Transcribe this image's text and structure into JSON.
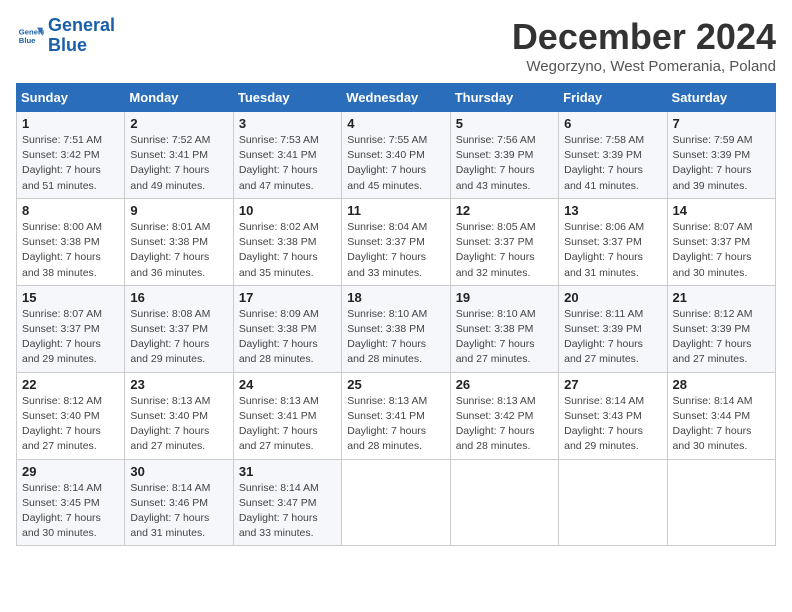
{
  "logo": {
    "line1": "General",
    "line2": "Blue"
  },
  "title": "December 2024",
  "subtitle": "Wegorzyno, West Pomerania, Poland",
  "headers": [
    "Sunday",
    "Monday",
    "Tuesday",
    "Wednesday",
    "Thursday",
    "Friday",
    "Saturday"
  ],
  "weeks": [
    [
      {
        "day": "1",
        "info": "Sunrise: 7:51 AM\nSunset: 3:42 PM\nDaylight: 7 hours\nand 51 minutes."
      },
      {
        "day": "2",
        "info": "Sunrise: 7:52 AM\nSunset: 3:41 PM\nDaylight: 7 hours\nand 49 minutes."
      },
      {
        "day": "3",
        "info": "Sunrise: 7:53 AM\nSunset: 3:41 PM\nDaylight: 7 hours\nand 47 minutes."
      },
      {
        "day": "4",
        "info": "Sunrise: 7:55 AM\nSunset: 3:40 PM\nDaylight: 7 hours\nand 45 minutes."
      },
      {
        "day": "5",
        "info": "Sunrise: 7:56 AM\nSunset: 3:39 PM\nDaylight: 7 hours\nand 43 minutes."
      },
      {
        "day": "6",
        "info": "Sunrise: 7:58 AM\nSunset: 3:39 PM\nDaylight: 7 hours\nand 41 minutes."
      },
      {
        "day": "7",
        "info": "Sunrise: 7:59 AM\nSunset: 3:39 PM\nDaylight: 7 hours\nand 39 minutes."
      }
    ],
    [
      {
        "day": "8",
        "info": "Sunrise: 8:00 AM\nSunset: 3:38 PM\nDaylight: 7 hours\nand 38 minutes."
      },
      {
        "day": "9",
        "info": "Sunrise: 8:01 AM\nSunset: 3:38 PM\nDaylight: 7 hours\nand 36 minutes."
      },
      {
        "day": "10",
        "info": "Sunrise: 8:02 AM\nSunset: 3:38 PM\nDaylight: 7 hours\nand 35 minutes."
      },
      {
        "day": "11",
        "info": "Sunrise: 8:04 AM\nSunset: 3:37 PM\nDaylight: 7 hours\nand 33 minutes."
      },
      {
        "day": "12",
        "info": "Sunrise: 8:05 AM\nSunset: 3:37 PM\nDaylight: 7 hours\nand 32 minutes."
      },
      {
        "day": "13",
        "info": "Sunrise: 8:06 AM\nSunset: 3:37 PM\nDaylight: 7 hours\nand 31 minutes."
      },
      {
        "day": "14",
        "info": "Sunrise: 8:07 AM\nSunset: 3:37 PM\nDaylight: 7 hours\nand 30 minutes."
      }
    ],
    [
      {
        "day": "15",
        "info": "Sunrise: 8:07 AM\nSunset: 3:37 PM\nDaylight: 7 hours\nand 29 minutes."
      },
      {
        "day": "16",
        "info": "Sunrise: 8:08 AM\nSunset: 3:37 PM\nDaylight: 7 hours\nand 29 minutes."
      },
      {
        "day": "17",
        "info": "Sunrise: 8:09 AM\nSunset: 3:38 PM\nDaylight: 7 hours\nand 28 minutes."
      },
      {
        "day": "18",
        "info": "Sunrise: 8:10 AM\nSunset: 3:38 PM\nDaylight: 7 hours\nand 28 minutes."
      },
      {
        "day": "19",
        "info": "Sunrise: 8:10 AM\nSunset: 3:38 PM\nDaylight: 7 hours\nand 27 minutes."
      },
      {
        "day": "20",
        "info": "Sunrise: 8:11 AM\nSunset: 3:39 PM\nDaylight: 7 hours\nand 27 minutes."
      },
      {
        "day": "21",
        "info": "Sunrise: 8:12 AM\nSunset: 3:39 PM\nDaylight: 7 hours\nand 27 minutes."
      }
    ],
    [
      {
        "day": "22",
        "info": "Sunrise: 8:12 AM\nSunset: 3:40 PM\nDaylight: 7 hours\nand 27 minutes."
      },
      {
        "day": "23",
        "info": "Sunrise: 8:13 AM\nSunset: 3:40 PM\nDaylight: 7 hours\nand 27 minutes."
      },
      {
        "day": "24",
        "info": "Sunrise: 8:13 AM\nSunset: 3:41 PM\nDaylight: 7 hours\nand 27 minutes."
      },
      {
        "day": "25",
        "info": "Sunrise: 8:13 AM\nSunset: 3:41 PM\nDaylight: 7 hours\nand 28 minutes."
      },
      {
        "day": "26",
        "info": "Sunrise: 8:13 AM\nSunset: 3:42 PM\nDaylight: 7 hours\nand 28 minutes."
      },
      {
        "day": "27",
        "info": "Sunrise: 8:14 AM\nSunset: 3:43 PM\nDaylight: 7 hours\nand 29 minutes."
      },
      {
        "day": "28",
        "info": "Sunrise: 8:14 AM\nSunset: 3:44 PM\nDaylight: 7 hours\nand 30 minutes."
      }
    ],
    [
      {
        "day": "29",
        "info": "Sunrise: 8:14 AM\nSunset: 3:45 PM\nDaylight: 7 hours\nand 30 minutes."
      },
      {
        "day": "30",
        "info": "Sunrise: 8:14 AM\nSunset: 3:46 PM\nDaylight: 7 hours\nand 31 minutes."
      },
      {
        "day": "31",
        "info": "Sunrise: 8:14 AM\nSunset: 3:47 PM\nDaylight: 7 hours\nand 33 minutes."
      },
      null,
      null,
      null,
      null
    ]
  ]
}
